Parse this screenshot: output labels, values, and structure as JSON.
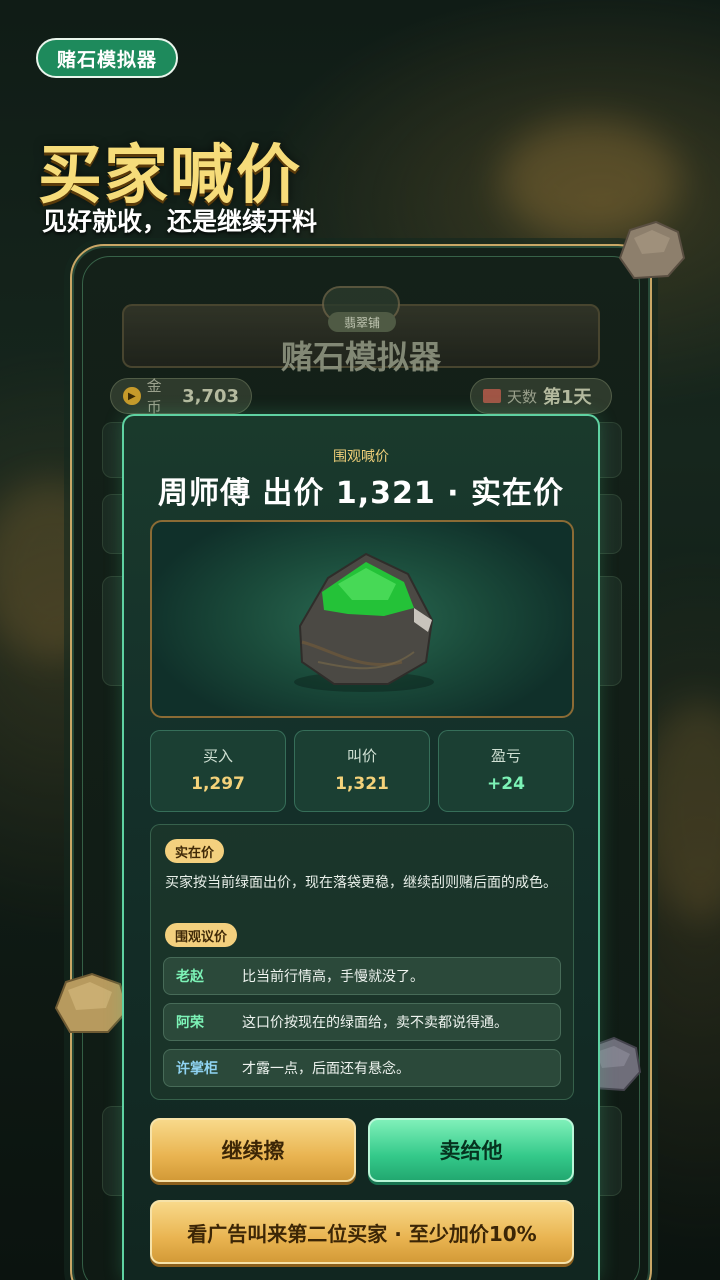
{
  "app_pill": {
    "label": "赌石模拟器"
  },
  "hero": {
    "title": "买家喊价",
    "subtitle": "见好就收，还是继续开料"
  },
  "game_bg": {
    "shop_tag": "翡翠铺",
    "game_title": "赌石模拟器",
    "coins_label": "金币",
    "coins_value": "3,703",
    "days_label": "天数",
    "days_value": "第1天"
  },
  "modal": {
    "kicker": "围观喊价",
    "headline": "周师傅 出价 1,321 · 实在价",
    "stats": [
      {
        "label": "买入",
        "value": "1,297"
      },
      {
        "label": "叫价",
        "value": "1,321"
      },
      {
        "label": "盈亏",
        "value": "+24"
      }
    ],
    "verdict_badge": "实在价",
    "advice": "买家按当前绿面出价，现在落袋更稳，继续刮则赌后面的成色。",
    "crowd_badge": "围观议价",
    "crowd": [
      {
        "name": "老赵",
        "comment": "比当前行情高，手慢就没了。",
        "color": "#7cf2b6"
      },
      {
        "name": "阿荣",
        "comment": "这口价按现在的绿面给，卖不卖都说得通。",
        "color": "#7cf2b6"
      },
      {
        "name": "许掌柜",
        "comment": "才露一点，后面还有悬念。",
        "color": "#8fd3f2"
      }
    ],
    "btn_continue": "继续擦",
    "btn_sell": "卖给他",
    "btn_ad": "看广告叫来第二位买家 · 至少加价10%"
  },
  "colors": {
    "accent_gold": "#f3d07e",
    "accent_green": "#5fd2a2",
    "title_gold": "#f6dc7a",
    "profit_green": "#7cf2b6"
  }
}
